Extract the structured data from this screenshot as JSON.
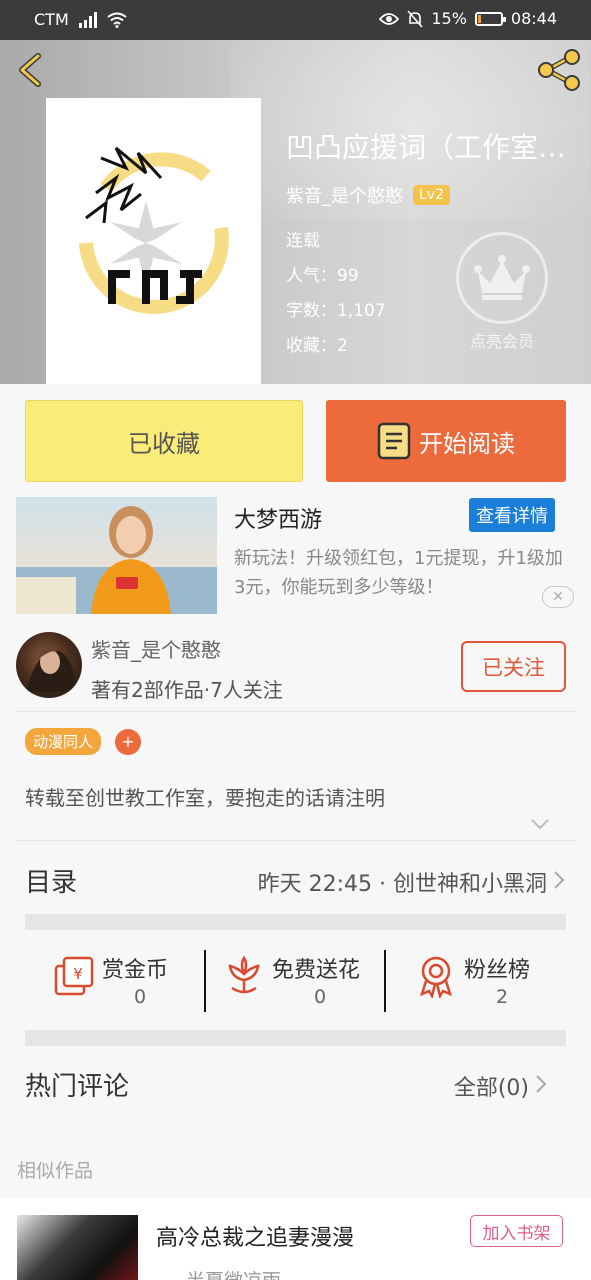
{
  "status_bar": {
    "carrier": "CTM",
    "battery": "15%",
    "battery_level": 0.15,
    "time": "08:44"
  },
  "header": {
    "title": "凹凸应援词（工作室…",
    "author": "紫音_是个憨憨",
    "level": "Lv2",
    "status": "连载",
    "popularity": "人气：99",
    "word_count": "字数：1,107",
    "favorites": "收藏：2",
    "vip_label": "点亮会员"
  },
  "actions": {
    "favorited_label": "已收藏",
    "read_label": "开始阅读"
  },
  "ad": {
    "title": "大梦西游",
    "detail_label": "查看详情",
    "description": "新玩法！升级领红包，1元提现，升1级加3元，你能玩到多少等级！"
  },
  "author_card": {
    "name": "紫音_是个憨憨",
    "summary": "著有2部作品·7人关注",
    "follow_label": "已关注"
  },
  "tags": [
    "动漫同人"
  ],
  "tag_add_label": "+",
  "description": "转载至创世教工作室，要抱走的话请注明",
  "catalog": {
    "label": "目录",
    "latest": "昨天 22:45 · 创世神和小黑洞"
  },
  "rewards": [
    {
      "label": "赏金币",
      "value": "0"
    },
    {
      "label": "免费送花",
      "value": "0"
    },
    {
      "label": "粉丝榜",
      "value": "2"
    }
  ],
  "comments": {
    "label": "热门评论",
    "all_label": "全部(0)"
  },
  "similar": {
    "section_title": "相似作品",
    "items": [
      {
        "title": "高冷总裁之追妻漫漫",
        "add_label": "加入书架",
        "author": "半夏微凉雨"
      }
    ]
  },
  "colors": {
    "accent_orange": "#ec6a3c",
    "favorite_yellow": "#faec79",
    "detail_blue": "#1b7fd9",
    "tag_orange": "#f3a63c",
    "pink": "#e35f8b"
  }
}
